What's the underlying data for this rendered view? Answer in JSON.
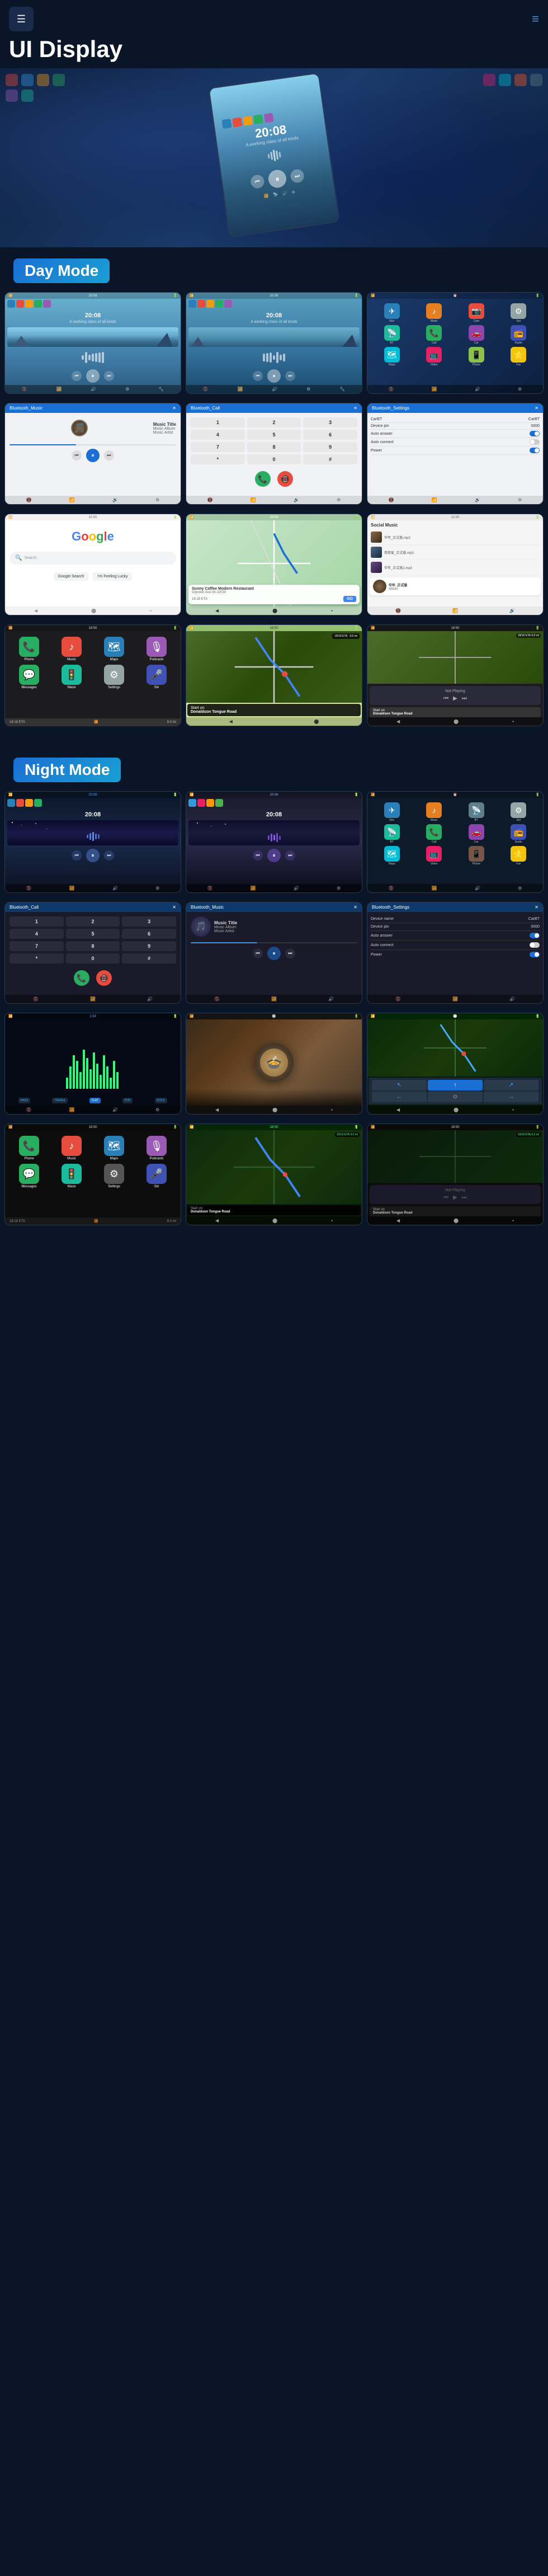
{
  "header": {
    "title": "UI Display",
    "hamburger": "☰",
    "menu": "≡"
  },
  "hero": {
    "time": "20:08",
    "subtitle": "A working class of all kinds"
  },
  "dayMode": {
    "label": "Day Mode",
    "screens": [
      {
        "type": "music",
        "time": "20:08",
        "subtitle": "A working class of all kinds"
      },
      {
        "type": "music2",
        "time": "20:08",
        "subtitle": "A working class of all kinds"
      },
      {
        "type": "appgrid"
      },
      {
        "type": "bluetooth_music",
        "title": "Bluetooth_Music"
      },
      {
        "type": "bluetooth_call",
        "title": "Bluetooth_Call"
      },
      {
        "type": "bluetooth_settings",
        "title": "Bluetooth_Settings"
      },
      {
        "type": "google"
      },
      {
        "type": "map_waze"
      },
      {
        "type": "social_music"
      }
    ]
  },
  "nightMode": {
    "label": "Night Mode",
    "screens": [
      {
        "type": "music_night1",
        "time": "20:08"
      },
      {
        "type": "music_night2",
        "time": "20:08"
      },
      {
        "type": "appgrid_night"
      },
      {
        "type": "bt_call_night",
        "title": "Bluetooth_Call"
      },
      {
        "type": "bt_music_night",
        "title": "Bluetooth_Music"
      },
      {
        "type": "bt_settings_night",
        "title": "Bluetooth_Settings"
      },
      {
        "type": "equalizer_night"
      },
      {
        "type": "food_image"
      },
      {
        "type": "map_night"
      }
    ]
  },
  "row2_day": [
    {
      "type": "carplay"
    },
    {
      "type": "map_nav"
    },
    {
      "type": "not_playing"
    }
  ],
  "row2_night": [
    {
      "type": "carplay_night"
    },
    {
      "type": "map_nav_night"
    },
    {
      "type": "not_playing_night"
    }
  ],
  "musicInfo": {
    "title": "Music Title",
    "album": "Music Album",
    "artist": "Music Artist"
  },
  "btSettings": {
    "deviceName": "CarBT",
    "devicePin": "0000",
    "autoAnswer": "Auto answer",
    "autoConnect": "Auto connect",
    "power": "Power"
  },
  "navCard": {
    "restaurant": "Sunny Coffee Modern Restaurant",
    "address": "Glyndon Ave,VA 22030",
    "eta": "18:18 ETA",
    "distance": "9.0 mi",
    "go": "GO"
  },
  "colors": {
    "accent": "#1a6fd4",
    "dayBg": "#0a1628",
    "nightBg": "#050a14",
    "cardBg": "#1a2535"
  }
}
